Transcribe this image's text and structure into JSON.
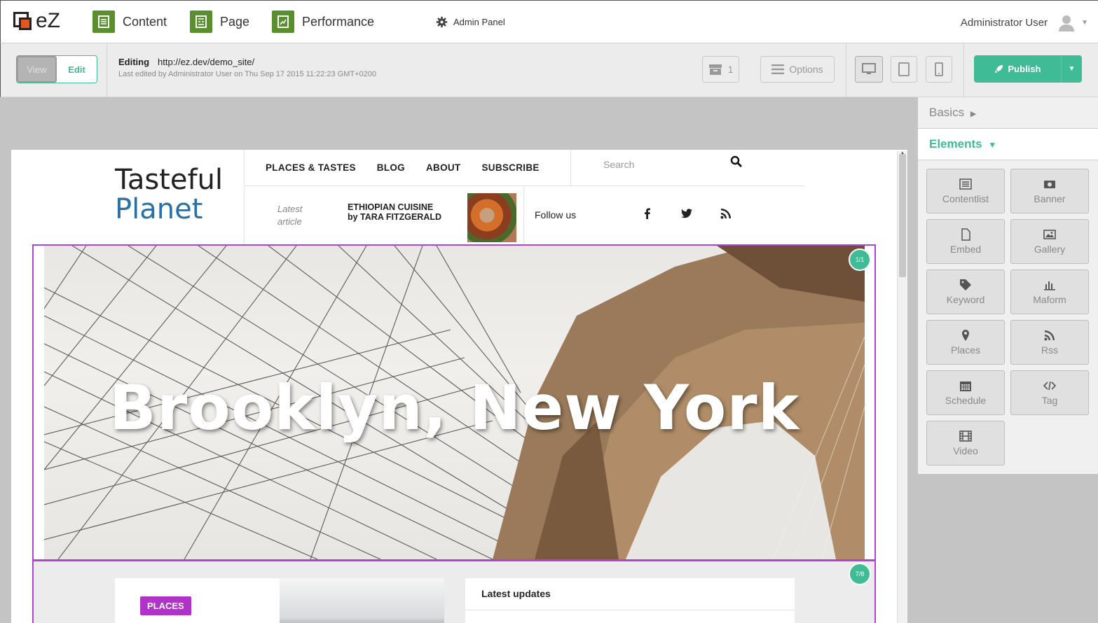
{
  "topbar": {
    "logo_text": "eZ",
    "nav": [
      {
        "label": "Content",
        "icon": "content-icon"
      },
      {
        "label": "Page",
        "icon": "page-icon"
      },
      {
        "label": "Performance",
        "icon": "performance-icon"
      }
    ],
    "admin_label": "Admin Panel",
    "user_name": "Administrator User"
  },
  "toolbar": {
    "view_label": "View",
    "edit_label": "Edit",
    "editing_label": "Editing",
    "editing_url": "http://ez.dev/demo_site/",
    "last_edited": "Last edited by Administrator User on Thu Sep 17 2015 11:22:23 GMT+0200",
    "archive_count": "1",
    "options_label": "Options",
    "publish_label": "Publish"
  },
  "panel": {
    "basics_label": "Basics",
    "elements_label": "Elements",
    "tiles": [
      {
        "label": "Contentlist",
        "icon": "list-icon"
      },
      {
        "label": "Banner",
        "icon": "banner-icon"
      },
      {
        "label": "Embed",
        "icon": "file-icon"
      },
      {
        "label": "Gallery",
        "icon": "image-icon"
      },
      {
        "label": "Keyword",
        "icon": "tag-icon"
      },
      {
        "label": "Maform",
        "icon": "bar-chart-icon"
      },
      {
        "label": "Places",
        "icon": "pin-icon"
      },
      {
        "label": "Rss",
        "icon": "rss-icon"
      },
      {
        "label": "Schedule",
        "icon": "calendar-icon"
      },
      {
        "label": "Tag",
        "icon": "code-icon"
      },
      {
        "label": "Video",
        "icon": "film-icon"
      }
    ]
  },
  "site": {
    "title_line1": "Tasteful",
    "title_line2": "Planet",
    "menu": [
      "PLACES & TASTES",
      "BLOG",
      "ABOUT",
      "SUBSCRIBE"
    ],
    "search_placeholder": "Search",
    "latest_label_1": "Latest",
    "latest_label_2": "article",
    "latest_title": "ETHIOPIAN CUISINE by TARA FITZGERALD",
    "follow_label": "Follow us",
    "hero_title": "Brooklyn, New York",
    "hero_badge": "1/1",
    "section_badge": "7/8",
    "places_tag": "PLACES",
    "updates_title": "Latest updates"
  },
  "colors": {
    "accent": "#3fbc96",
    "brand_green": "#5a8f2e",
    "zone_border": "#b442d4",
    "places_tag": "#b033c8",
    "planet_blue": "#2a6fa8"
  }
}
